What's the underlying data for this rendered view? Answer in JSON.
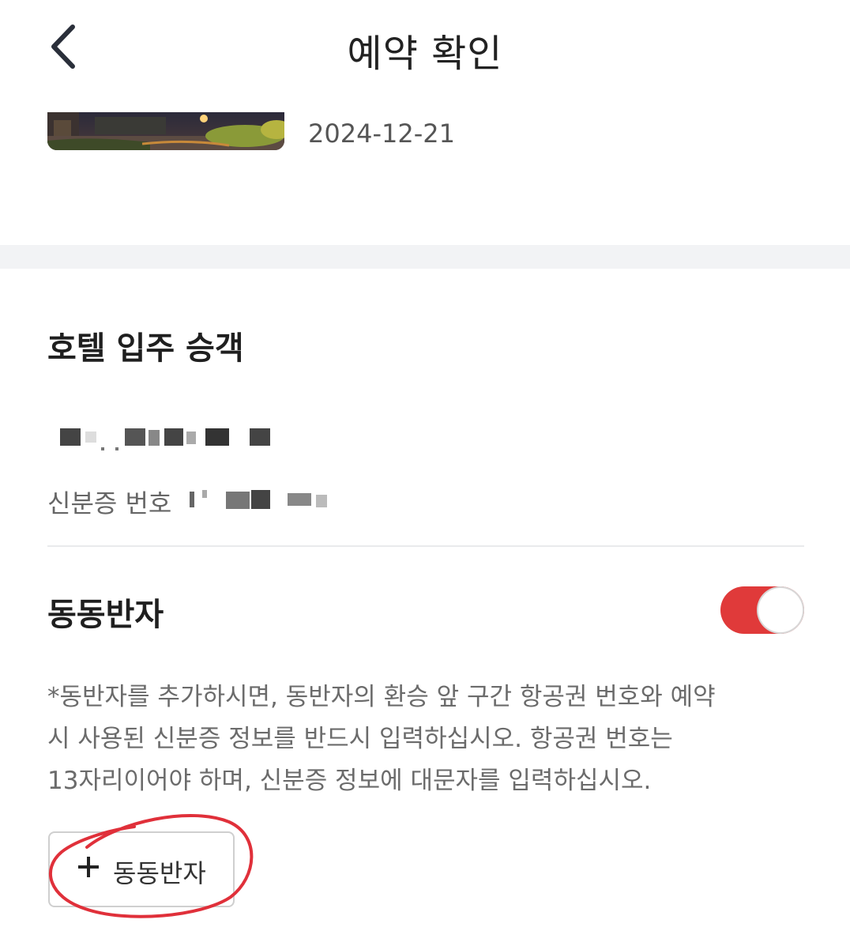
{
  "header": {
    "title": "예약 확인",
    "back_icon": "chevron-left-icon"
  },
  "booking": {
    "date": "2024-12-21",
    "thumbnail": "hotel-night-photo"
  },
  "guests_section": {
    "title": "호텔 입주 승객",
    "id_label": "신분증 번호"
  },
  "companion_section": {
    "title": "동동반자",
    "toggle_on": true,
    "notice_lines": [
      "*동반자를 추가하시면, 동반자의 환승 앞 구간 항공권 번호와 예약",
      "시 사용된 신분증 정보를 반드시 입력하십시오. 항공권 번호는",
      "13자리이어야 하며, 신분증 정보에 대문자를 입력하십시오."
    ],
    "add_button_label": "동동반자",
    "add_icon": "plus-icon"
  },
  "colors": {
    "accent": "#e03a3a",
    "annotation": "#e0303a",
    "divider": "#f2f3f5"
  }
}
